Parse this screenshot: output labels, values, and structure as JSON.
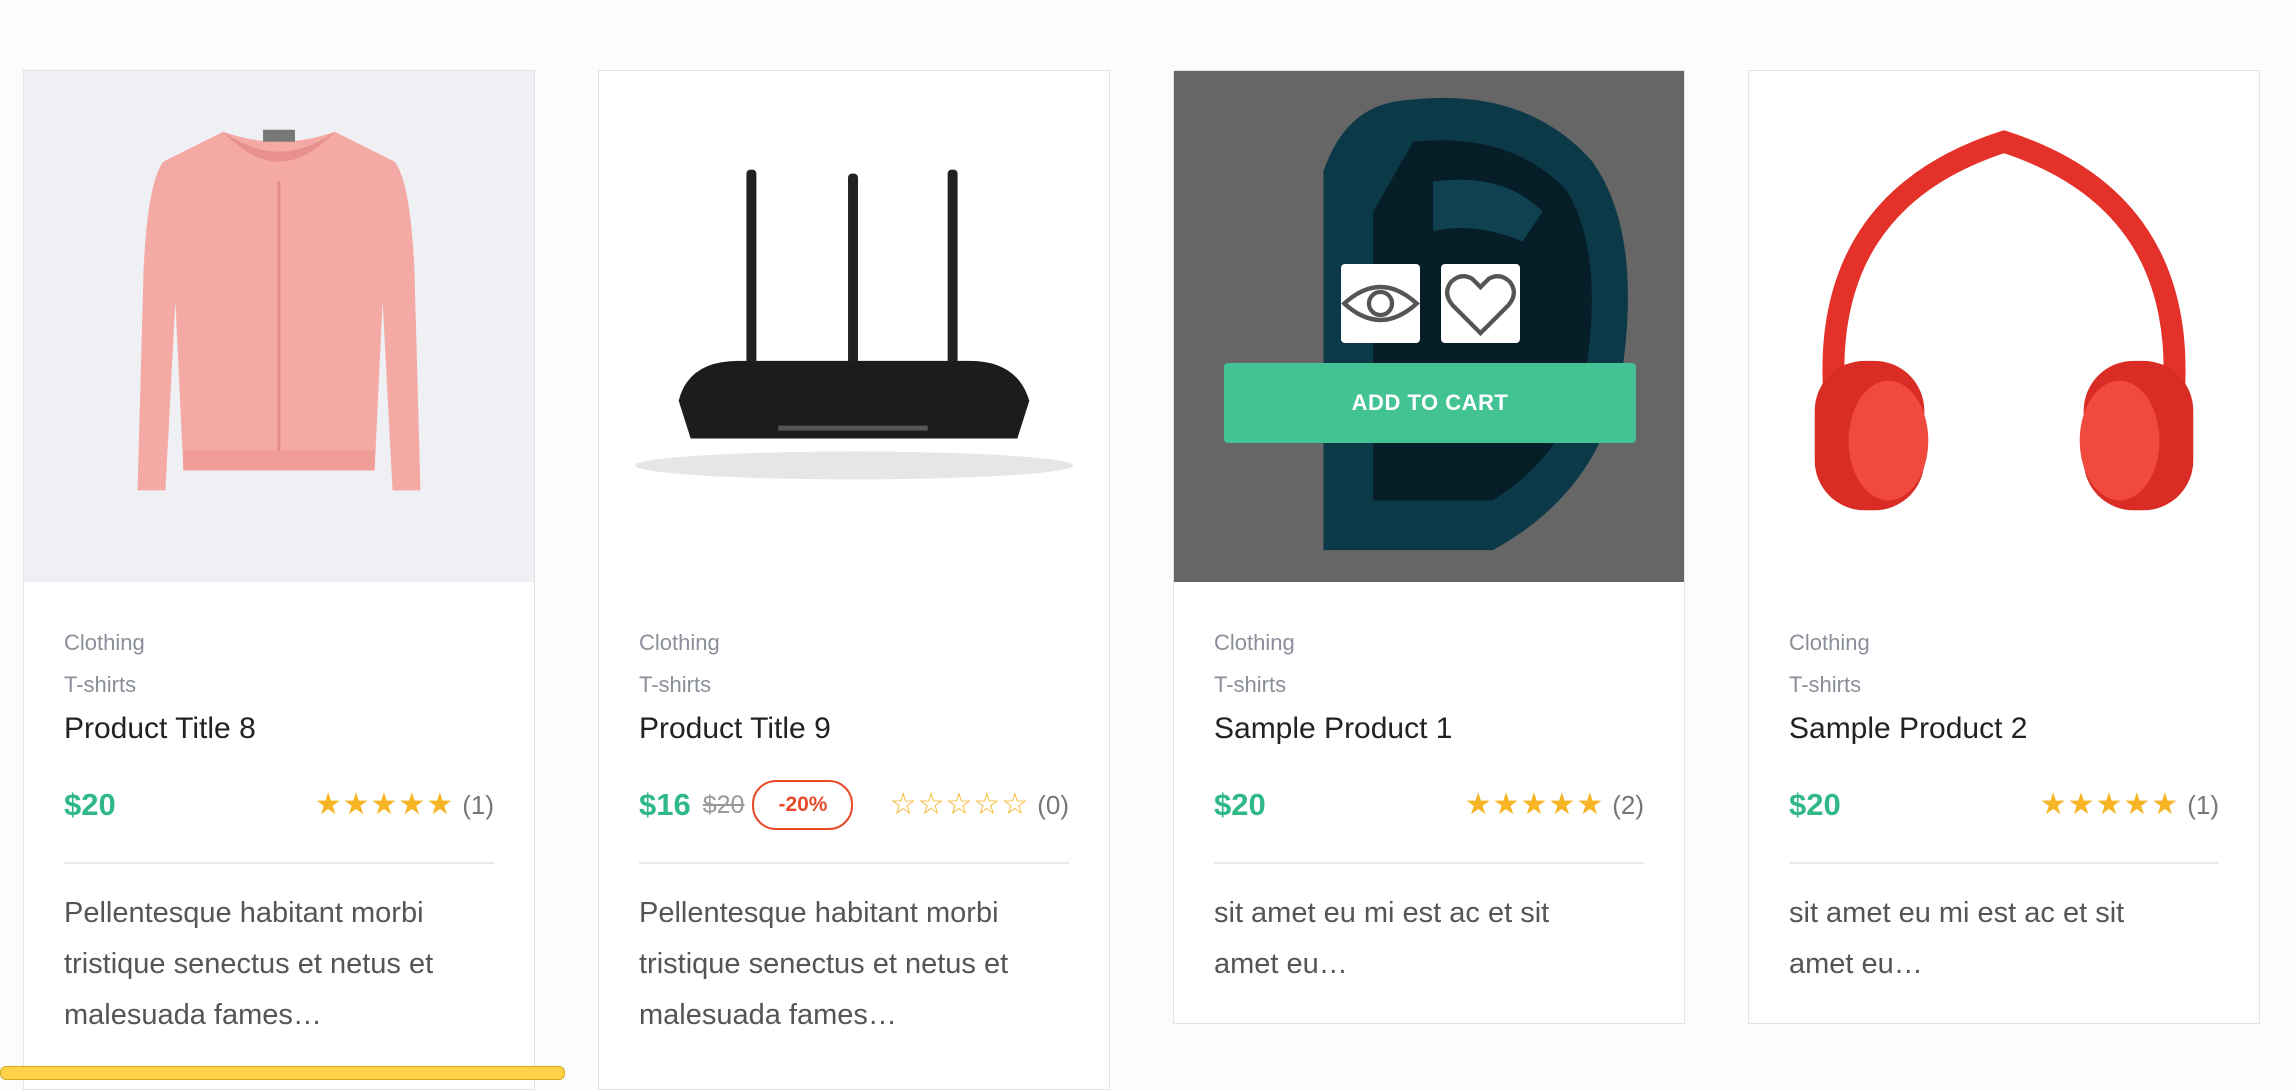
{
  "products": [
    {
      "category": "Clothing",
      "subcategory": "T-shirts",
      "title": "Product Title 8",
      "price": "$20",
      "rating_stars": "★★★★★",
      "rating_count": "(1)",
      "description_line1": "Pellentesque habitant morbi",
      "description_line2": "tristique senectus et netus et",
      "description_line3": "malesuada fames…"
    },
    {
      "category": "Clothing",
      "subcategory": "T-shirts",
      "title": "Product Title 9",
      "price": "$16",
      "old_price": "$20",
      "discount": "-20%",
      "rating_stars": "☆☆☆☆☆",
      "rating_count": "(0)",
      "description_line1": "Pellentesque habitant morbi",
      "description_line2": "tristique senectus et netus et",
      "description_line3": "malesuada fames…"
    },
    {
      "category": "Clothing",
      "subcategory": "T-shirts",
      "title": "Sample Product 1",
      "price": "$20",
      "rating_stars": "★★★★★",
      "rating_count": "(2)",
      "add_to_cart": "ADD TO CART",
      "description_line1": "sit amet eu mi est ac et sit",
      "description_line2": "amet eu…"
    },
    {
      "category": "Clothing",
      "subcategory": "T-shirts",
      "title": "Sample Product 2",
      "price": "$20",
      "rating_stars": "★★★★★",
      "rating_count": "(1)",
      "description_line1": "sit amet eu mi est ac et sit",
      "description_line2": "amet eu…"
    }
  ],
  "colors": {
    "accent": "#43c293",
    "price": "#30b886",
    "star": "#f7b425",
    "discount": "#e84b2a"
  },
  "icons": [
    "eye-icon",
    "heart-icon"
  ]
}
